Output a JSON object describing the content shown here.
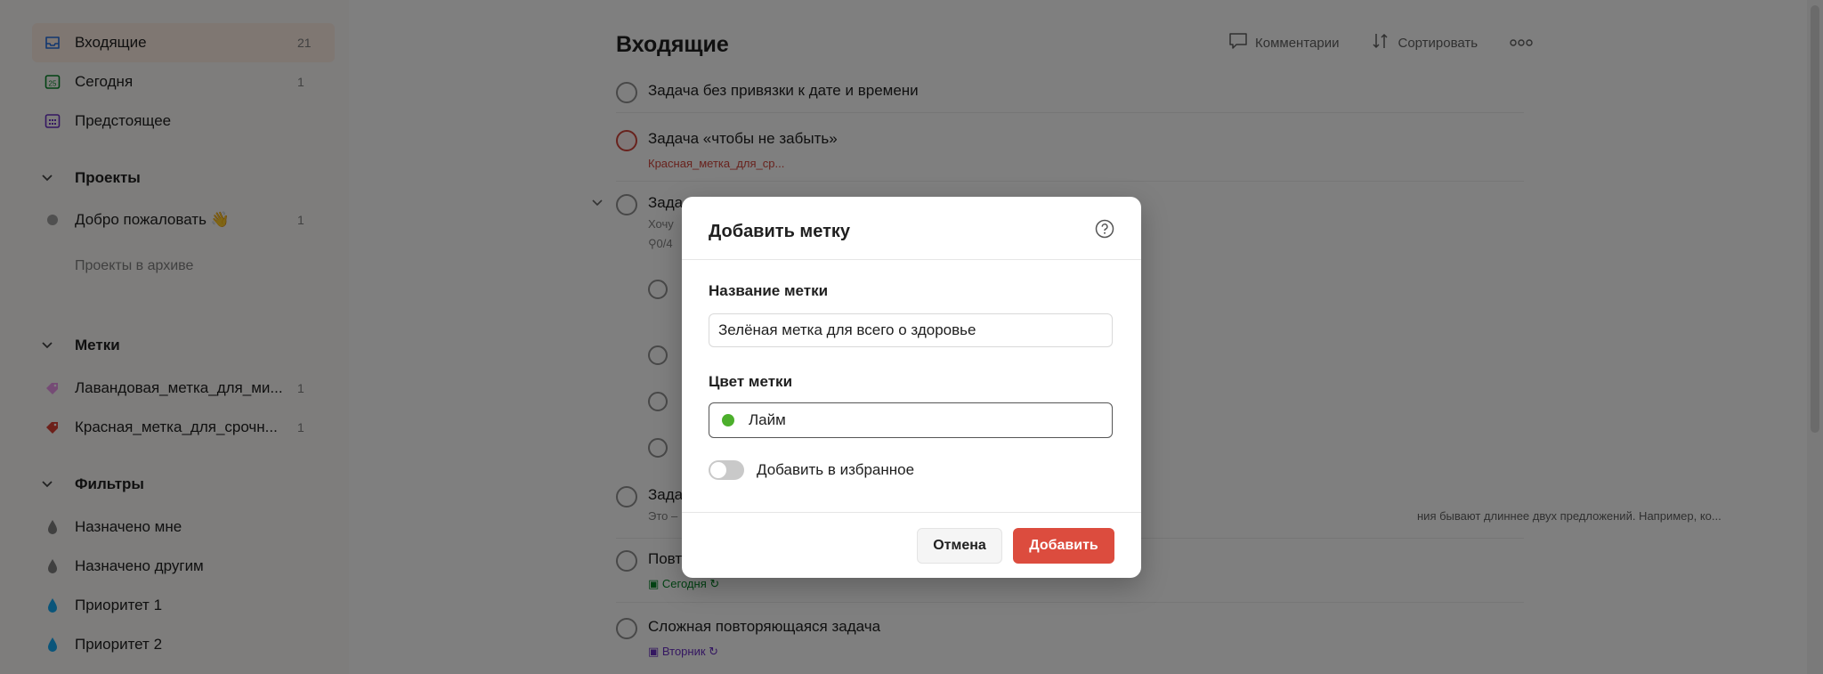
{
  "sidebar": {
    "nav": [
      {
        "label": "Входящие",
        "count": "21"
      },
      {
        "label": "Сегодня",
        "count": "1",
        "date_icon_text": "25"
      },
      {
        "label": "Предстоящее",
        "count": ""
      }
    ],
    "projects_header": "Проекты",
    "projects": [
      {
        "label": "Добро пожаловать",
        "count": "1",
        "emoji": "👋"
      }
    ],
    "archive_label": "Проекты в архиве",
    "labels_header": "Метки",
    "labels": [
      {
        "label": "Лавандовая_метка_для_ми...",
        "count": "1",
        "color": "#eb96eb"
      },
      {
        "label": "Красная_метка_для_срочн...",
        "count": "1",
        "color": "#db4035"
      }
    ],
    "filters_header": "Фильтры",
    "filters": [
      {
        "label": "Назначено мне",
        "color": "#808080"
      },
      {
        "label": "Назначено другим",
        "color": "#808080"
      },
      {
        "label": "Приоритет 1",
        "color": "#14aaf5"
      },
      {
        "label": "Приоритет 2",
        "color": "#14aaf5"
      }
    ]
  },
  "main": {
    "title": "Входящие",
    "toolbar": {
      "comments": "Комментарии",
      "sort": "Сортировать",
      "more_icon": "more-dots-icon"
    },
    "tasks": [
      {
        "title": "Задача без привязки к дате и времени"
      },
      {
        "title": "Задача «чтобы не забыть»",
        "meta": "Красная_метка_для_ср..."
      },
      {
        "title": "Зада",
        "sub": "Хочу",
        "subtasks": "0/4"
      },
      {
        "title": "Зада",
        "sub": "Это –",
        "sub_right": "ния бывают длиннее двух предложений. Например, ко..."
      },
      {
        "title": "Повт",
        "meta": "Сегодня"
      },
      {
        "title": "Сложная повторяющаяся задача",
        "meta": "Вторник"
      }
    ]
  },
  "modal": {
    "title": "Добавить метку",
    "name_label": "Название метки",
    "name_value": "Зелёная метка для всего о здоровье",
    "color_label": "Цвет метки",
    "color_value": "Лайм",
    "color_hex": "#4caf2c",
    "favorite_label": "Добавить в избранное",
    "favorite_on": false,
    "cancel": "Отмена",
    "add": "Добавить"
  },
  "colors": {
    "accent": "#dc4c3e",
    "overlay": "rgba(0,0,0,0.5)"
  }
}
